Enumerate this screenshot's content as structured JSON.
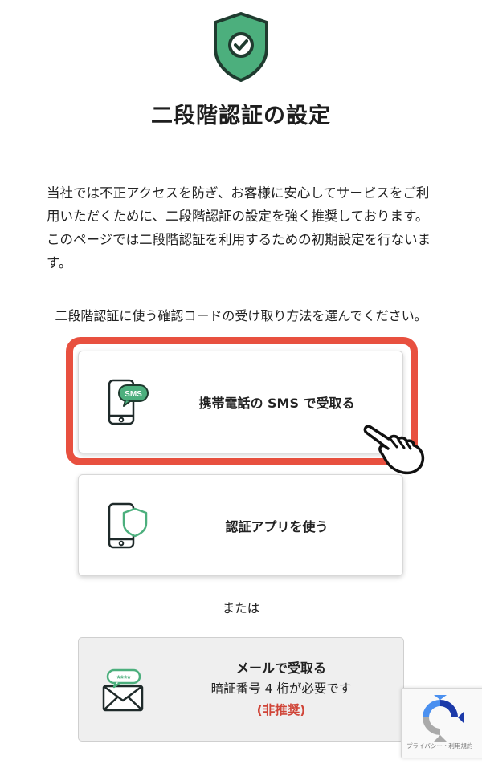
{
  "header": {
    "title": "二段階認証の設定"
  },
  "intro": {
    "text": "当社では不正アクセスを防ぎ、お客様に安心してサービスをご利用いただくために、二段階認証の設定を強く推奨しております。このページでは二段階認証を利用するための初期設定を行ないます。"
  },
  "instruction": {
    "text": "二段階認証に使う確認コードの受け取り方法を選んでください。"
  },
  "options": {
    "sms": {
      "label": "携帯電話の SMS で受取る",
      "icon_badge": "SMS",
      "icon": "phone-sms-icon"
    },
    "app": {
      "label": "認証アプリを使う",
      "icon": "phone-shield-icon"
    },
    "separator": "または",
    "mail": {
      "title": "メールで受取る",
      "subtitle": "暗証番号 4 桁が必要です",
      "note": "(非推奨)",
      "icon_badge": "****",
      "icon": "envelope-icon"
    }
  },
  "recaptcha": {
    "links": "プライバシー・利用規約"
  },
  "colors": {
    "accent_green": "#4caf7d",
    "highlight_red": "#e8503f",
    "warning_red": "#d04538"
  }
}
